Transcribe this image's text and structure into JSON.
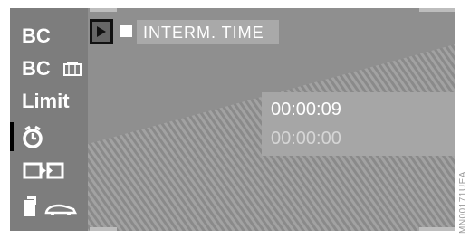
{
  "sidebar": {
    "items": [
      {
        "label": "BC",
        "icon": ""
      },
      {
        "label": "BC",
        "icon": "memory-card-icon"
      },
      {
        "label": "Limit",
        "icon": ""
      },
      {
        "label": "",
        "icon": "stopwatch-icon"
      },
      {
        "label": "",
        "icon": "split-screen-icon"
      },
      {
        "label": "",
        "icon": "doors-car-icon"
      }
    ]
  },
  "toolbar": {
    "play_icon": "play-icon",
    "stop_icon": "stop-icon",
    "interm_label": "INTERM. TIME"
  },
  "timer": {
    "current": "00:00:09",
    "secondary": "00:00:00"
  },
  "image_code": "MN00171UEA",
  "colors": {
    "screen_bg": "#8d8d8d",
    "sidebar_bg": "#7d7d7d",
    "panel_bg": "#a6a6a6",
    "text": "#ffffff"
  }
}
